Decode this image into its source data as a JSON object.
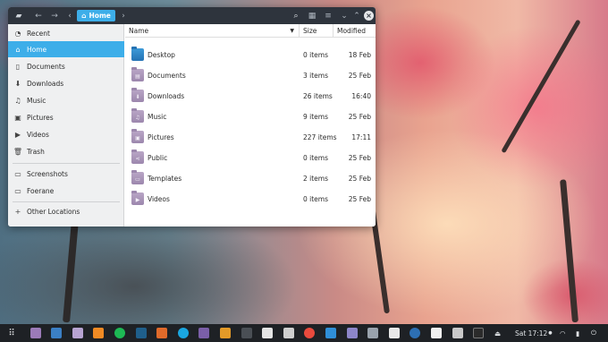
{
  "window": {
    "title_crumb": "Home",
    "icons": {
      "app": "folder-icon",
      "back": "arrow-left-icon",
      "forward": "arrow-right-icon",
      "crumb_left": "chevron-left-icon",
      "crumb_right": "chevron-right-icon",
      "search": "search-icon",
      "view": "view-grid-icon",
      "menu": "hamburger-menu-icon",
      "minimize": "chevron-down-icon",
      "maximize": "chevron-up-icon",
      "close": "close-icon"
    }
  },
  "sidebar": {
    "items": [
      {
        "label": "Recent",
        "icon": "clock-icon"
      },
      {
        "label": "Home",
        "icon": "home-icon",
        "active": true
      },
      {
        "label": "Documents",
        "icon": "document-icon"
      },
      {
        "label": "Downloads",
        "icon": "download-icon"
      },
      {
        "label": "Music",
        "icon": "music-note-icon"
      },
      {
        "label": "Pictures",
        "icon": "image-icon"
      },
      {
        "label": "Videos",
        "icon": "video-icon"
      },
      {
        "label": "Trash",
        "icon": "trash-icon"
      }
    ],
    "devices": [
      {
        "label": "Screenshots",
        "icon": "drive-icon"
      },
      {
        "label": "Foerane",
        "icon": "drive-icon"
      }
    ],
    "other": {
      "label": "Other Locations",
      "icon": "plus-icon"
    }
  },
  "columns": {
    "name": "Name",
    "size": "Size",
    "modified": "Modified"
  },
  "files": [
    {
      "name": "Desktop",
      "size": "0 items",
      "modified": "18 Feb",
      "icon": "desktop-folder-icon"
    },
    {
      "name": "Documents",
      "size": "3 items",
      "modified": "25 Feb",
      "icon": "documents-folder-icon"
    },
    {
      "name": "Downloads",
      "size": "26 items",
      "modified": "16:40",
      "icon": "downloads-folder-icon"
    },
    {
      "name": "Music",
      "size": "9 items",
      "modified": "25 Feb",
      "icon": "music-folder-icon"
    },
    {
      "name": "Pictures",
      "size": "227 items",
      "modified": "17:11",
      "icon": "pictures-folder-icon"
    },
    {
      "name": "Public",
      "size": "0 items",
      "modified": "25 Feb",
      "icon": "public-folder-icon"
    },
    {
      "name": "Templates",
      "size": "2 items",
      "modified": "25 Feb",
      "icon": "templates-folder-icon"
    },
    {
      "name": "Videos",
      "size": "0 items",
      "modified": "25 Feb",
      "icon": "videos-folder-icon"
    }
  ],
  "taskbar": {
    "clock": "Sat 17:12",
    "apps": [
      "app-grid-icon",
      "purple-app-icon",
      "photo-app-icon",
      "files-app-icon",
      "orange-app-icon",
      "spotify-icon",
      "steam-icon",
      "store-icon",
      "skype-icon",
      "purple-app-icon",
      "media-player-icon",
      "terminal-app-icon",
      "music-app-icon",
      "photos-app-icon",
      "maps-icon",
      "calculator-icon",
      "text-editor-icon",
      "notes-icon",
      "document-viewer-icon",
      "settings-icon",
      "web-browser-icon",
      "archive-icon",
      "terminal-icon"
    ],
    "tray": [
      "eject-icon",
      "wifi-icon",
      "battery-icon",
      "power-icon"
    ]
  },
  "colors": {
    "accent": "#3daee9",
    "titlebar": "#2e343d",
    "taskbar": "#1e2125"
  }
}
